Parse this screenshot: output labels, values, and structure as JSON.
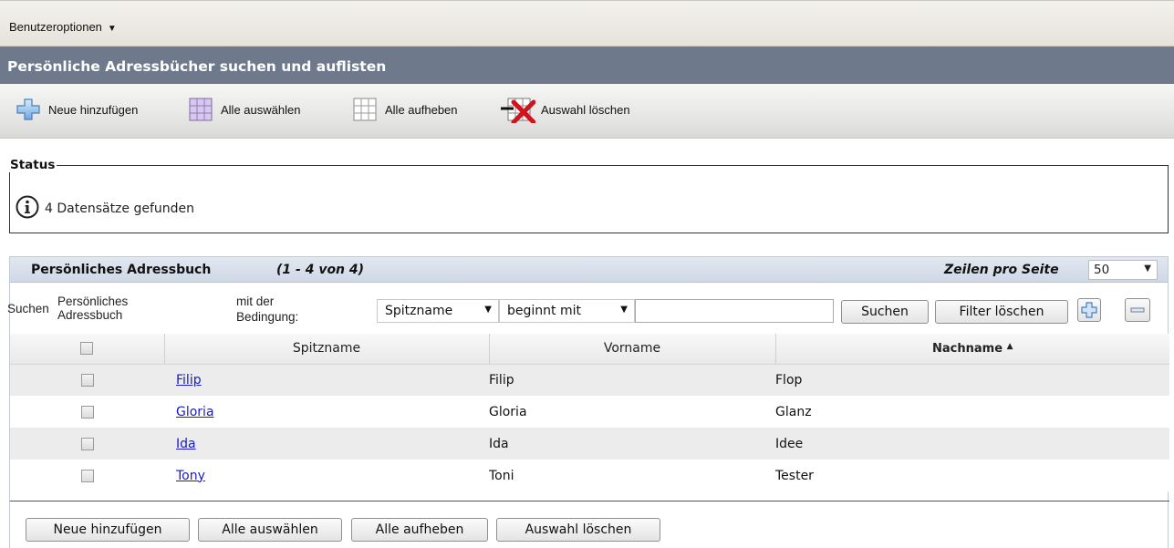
{
  "topbar": {
    "user_options": "Benutzeroptionen"
  },
  "page": {
    "title": "Persönliche Adressbücher suchen und auflisten"
  },
  "toolbar": {
    "add_new": "Neue hinzufügen",
    "select_all": "Alle auswählen",
    "deselect_all": "Alle aufheben",
    "delete_selected": "Auswahl löschen"
  },
  "status": {
    "legend": "Status",
    "message": "4 Datensätze gefunden"
  },
  "panel": {
    "title": "Persönliches Adressbuch",
    "count": "(1 - 4 von 4)",
    "rows_per_page_label": "Zeilen pro Seite",
    "rows_per_page": "50"
  },
  "search": {
    "label": "Suchen",
    "field_label_1": "Persönliches",
    "field_label_2": "Adressbuch",
    "condition_label_1": "mit der",
    "condition_label_2": "Bedingung:",
    "field_select": "Spitzname",
    "condition_select": "beginnt mit",
    "value": "",
    "search_button": "Suchen",
    "clear_button": "Filter löschen"
  },
  "table": {
    "columns": [
      "Spitzname",
      "Vorname",
      "Nachname"
    ],
    "sort_column": "Nachname",
    "rows": [
      {
        "nickname": "Filip",
        "first_name": "Filip",
        "last_name": "Flop"
      },
      {
        "nickname": "Gloria",
        "first_name": "Gloria",
        "last_name": "Glanz"
      },
      {
        "nickname": "Ida",
        "first_name": "Ida",
        "last_name": "Idee"
      },
      {
        "nickname": "Tony",
        "first_name": "Toni",
        "last_name": "Tester"
      }
    ]
  },
  "bottom": {
    "add_new": "Neue hinzufügen",
    "select_all": "Alle auswählen",
    "deselect_all": "Alle aufheben",
    "delete_selected": "Auswahl löschen"
  },
  "colors": {
    "title_bar": "#6e7a8c",
    "link": "#1a1ac8",
    "row_alt": "#ececec",
    "delete_red": "#d0141e"
  },
  "icons": {
    "add": "plus-icon",
    "select_all": "grid-filled-icon",
    "deselect_all": "grid-empty-icon",
    "delete": "grid-delete-icon",
    "info": "info-icon",
    "sort": "sort-ascending-icon"
  }
}
